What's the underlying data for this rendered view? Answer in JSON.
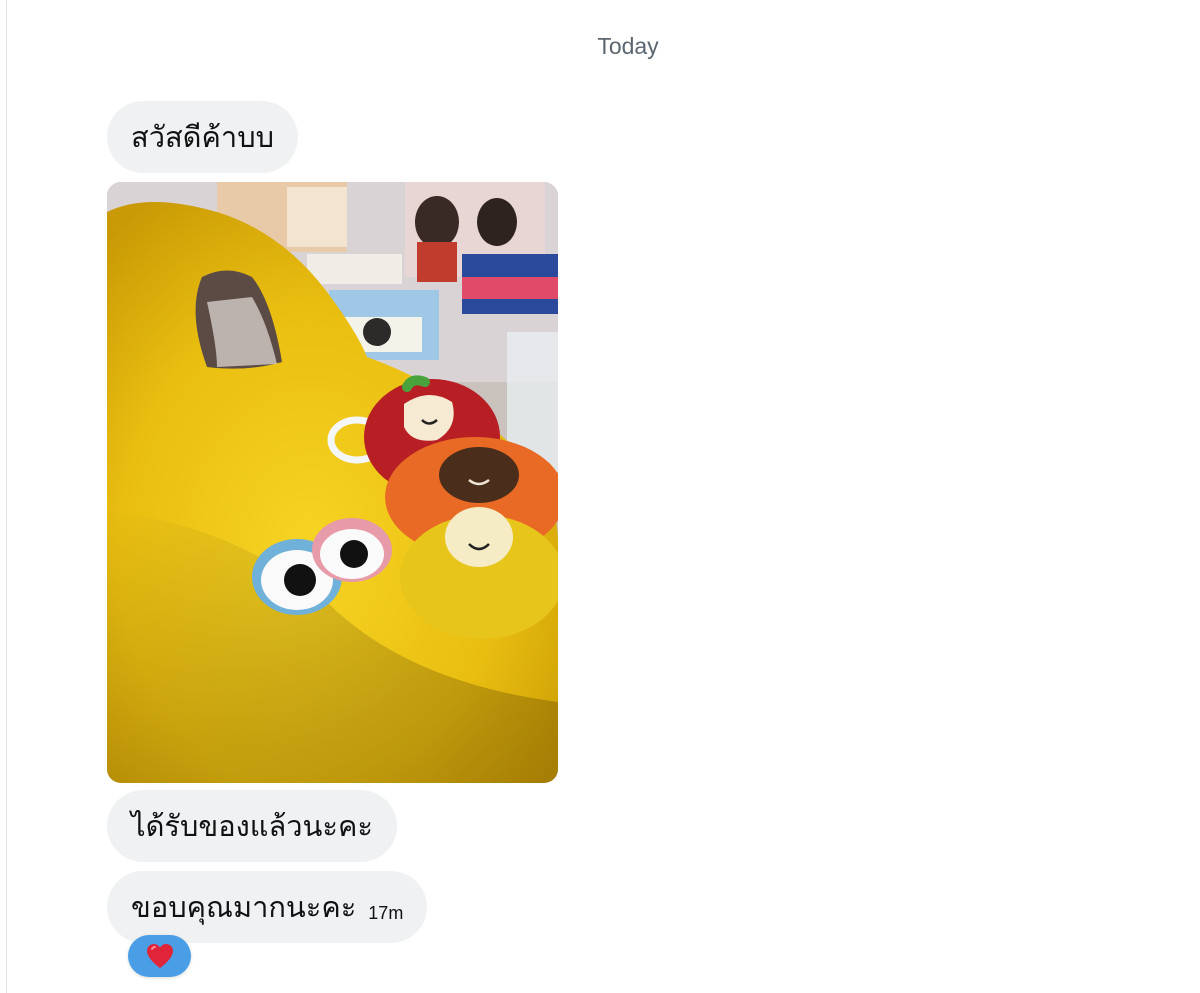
{
  "date_separator": "Today",
  "messages": [
    {
      "text": "สวัสดีค้าบบ"
    },
    {
      "image_alt": "photo message"
    },
    {
      "text": "ได้รับของแล้วนะคะ"
    },
    {
      "text": "ขอบคุณมากนะคะ",
      "time": "17m"
    }
  ],
  "reaction": {
    "icon": "heart-icon",
    "color": "#e0243a",
    "badge_color": "#4a9ee5"
  }
}
